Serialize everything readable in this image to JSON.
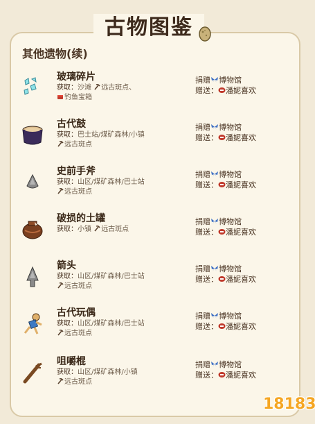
{
  "page_title": "古物图鉴",
  "section_title": "其他遗物(续)",
  "labels": {
    "source_prefix": "获取：",
    "donate_prefix": "捐赠",
    "donate_target": "博物馆",
    "gift_prefix": "赠送：",
    "gift_target": "潘妮喜欢"
  },
  "items": [
    {
      "name": "玻璃碎片",
      "source_line1": "沙滩",
      "source_line1b": "远古斑点、",
      "source_line2": "钓鱼宝箱",
      "icon": "glass-shards-icon"
    },
    {
      "name": "古代鼓",
      "source_line1": "巴士站/煤矿森林/小镇",
      "source_line2": "远古斑点",
      "icon": "ancient-drum-icon"
    },
    {
      "name": "史前手斧",
      "source_line1": "山区/煤矿森林/巴士站",
      "source_line2": "远古斑点",
      "icon": "prehistoric-handaxe-icon"
    },
    {
      "name": "破损的土罐",
      "source_line1": "小镇",
      "source_line1b": "远古斑点",
      "source_line2": "",
      "icon": "chipped-amphora-icon"
    },
    {
      "name": "箭头",
      "source_line1": "山区/煤矿森林/巴士站",
      "source_line2": "远古斑点",
      "icon": "arrowhead-icon"
    },
    {
      "name": "古代玩偶",
      "source_line1": "山区/煤矿森林/巴士站",
      "source_line2": "远古斑点",
      "icon": "ancient-doll-icon"
    },
    {
      "name": "咀嚼棍",
      "source_line1": "山区/煤矿森林/小镇",
      "source_line2": "远古斑点",
      "icon": "chewing-stick-icon"
    }
  ],
  "logo_text": "18183",
  "colors": {
    "background": "#f2ead8",
    "card": "#fbf6e9",
    "border": "#d9c9a7",
    "text": "#4a3423",
    "logo": "#f5a623"
  }
}
